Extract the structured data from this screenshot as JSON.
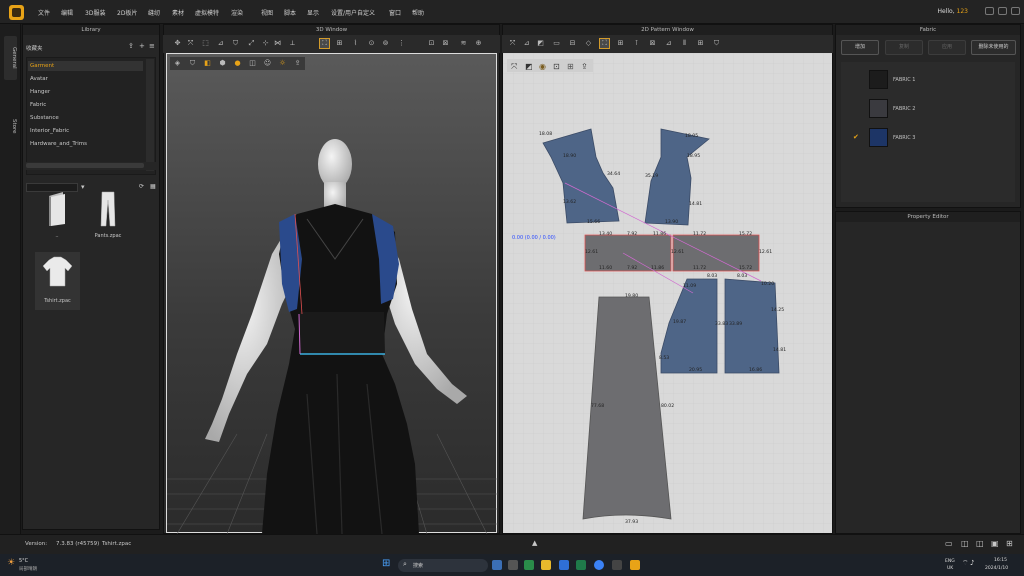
{
  "menubar": {
    "items": [
      "文件",
      "编辑",
      "3D服装",
      "2D板片",
      "缝纫",
      "素材",
      "虚拟模特",
      "渲染",
      "视图",
      "脚本",
      "显示",
      "设置/用户自定义",
      "窗口",
      "帮助"
    ],
    "greeting": "Hello,",
    "user": "123"
  },
  "side_tabs": [
    "General",
    "Store"
  ],
  "library": {
    "title": "Library",
    "favorites_label": "收藏夹",
    "items": [
      "Garment",
      "Avatar",
      "Hanger",
      "Fabric",
      "Substance",
      "Interior_Fabric",
      "Hardware_and_Trims"
    ],
    "selected": "Garment",
    "files": [
      {
        "name": "..",
        "icon": "folder-icon"
      },
      {
        "name": "Pants.zpac",
        "icon": "pants-icon"
      },
      {
        "name": "Tshirt.zpac",
        "icon": "tshirt-icon"
      }
    ]
  },
  "window_3d": {
    "title": "3D Window"
  },
  "window_2d": {
    "title": "2D Pattern Window",
    "origin_readout": "0.00 (0.00 / 0.00)",
    "measurements": [
      "18.08",
      "18.90",
      "34.64",
      "13.62",
      "15.66",
      "18.05",
      "18.95",
      "35.19",
      "14.81",
      "13.90",
      "13.40",
      "7.92",
      "11.86",
      "12.61",
      "11.60",
      "7.92",
      "11.86",
      "11.72",
      "15.72",
      "11.72",
      "15.72",
      "12.61",
      "12.61",
      "19.80",
      "77.68",
      "80.02",
      "37.93",
      "11.09",
      "8.03",
      "19.87",
      "33.83",
      "8.53",
      "20.95",
      "8.03",
      "10.20",
      "33.89",
      "14.25",
      "14.81",
      "16.86"
    ]
  },
  "fabric": {
    "title": "Fabric",
    "buttons": [
      "增加",
      "复制",
      "应用",
      "删除未使用的"
    ],
    "items": [
      {
        "name": "FABRIC 1",
        "color": "#1c1c1c",
        "active": false
      },
      {
        "name": "FABRIC 2",
        "color": "#3a3a3f",
        "active": false
      },
      {
        "name": "FABRIC 3",
        "color": "#1d3566",
        "active": true
      }
    ]
  },
  "property_editor": {
    "title": "Property Editor"
  },
  "status": {
    "version_label": "Version:",
    "version_value": "7.3.83 (r45759)",
    "file": "Tshirt.zpac"
  },
  "taskbar": {
    "weather_temp": "5°C",
    "weather_desc": "局部晴朗",
    "search_placeholder": "搜索",
    "lang_top": "ENG",
    "lang_bottom": "UK",
    "time": "16:15",
    "date": "2024/1/10"
  },
  "colors": {
    "accent": "#e8a317",
    "pattern_blue": "#4e6587",
    "pattern_gray": "#6d6d70"
  }
}
